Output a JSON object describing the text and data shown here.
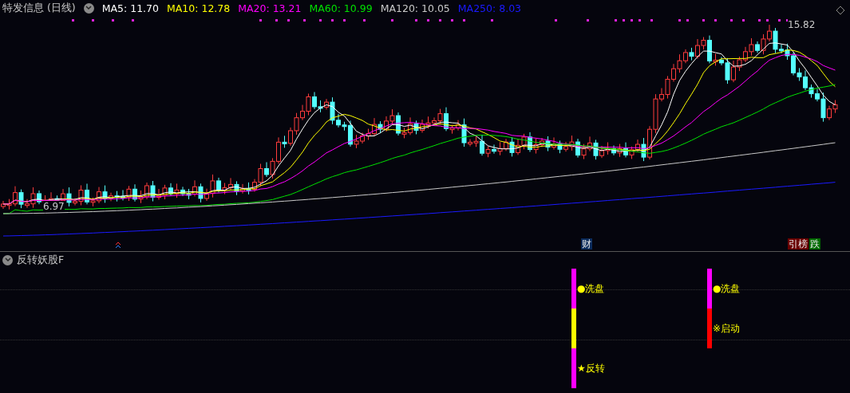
{
  "main_panel": {
    "title": "特发信息 (日线)",
    "indicators": [
      {
        "label": "MA5: 11.70",
        "color": "#ffffff"
      },
      {
        "label": "MA10: 12.78",
        "color": "#ffff00"
      },
      {
        "label": "MA20: 13.21",
        "color": "#ff00ff"
      },
      {
        "label": "MA60: 10.99",
        "color": "#00e000"
      },
      {
        "label": "MA120: 10.05",
        "color": "#c8c8c8"
      },
      {
        "label": "MA250: 8.03",
        "color": "#1a1aff"
      }
    ],
    "high_label": "15.82",
    "low_label": "6.97",
    "event_marks": [
      {
        "text": "财",
        "color": "#0a2a5a"
      },
      {
        "text": "引榜",
        "color": "#6a0000"
      },
      {
        "text": "跌",
        "color": "#006a00"
      }
    ]
  },
  "sub_panel": {
    "title": "反转妖股F",
    "signals": [
      {
        "segments": [
          {
            "color": "#ff00ff",
            "label": "●洗盘"
          },
          {
            "color": "#ffff00"
          },
          {
            "color": "#ff00ff",
            "label": "★反转"
          }
        ]
      },
      {
        "segments": [
          {
            "color": "#ff00ff",
            "label": "●洗盘"
          },
          {
            "color": "#ff0000",
            "label": "※启动"
          }
        ]
      }
    ]
  }
}
